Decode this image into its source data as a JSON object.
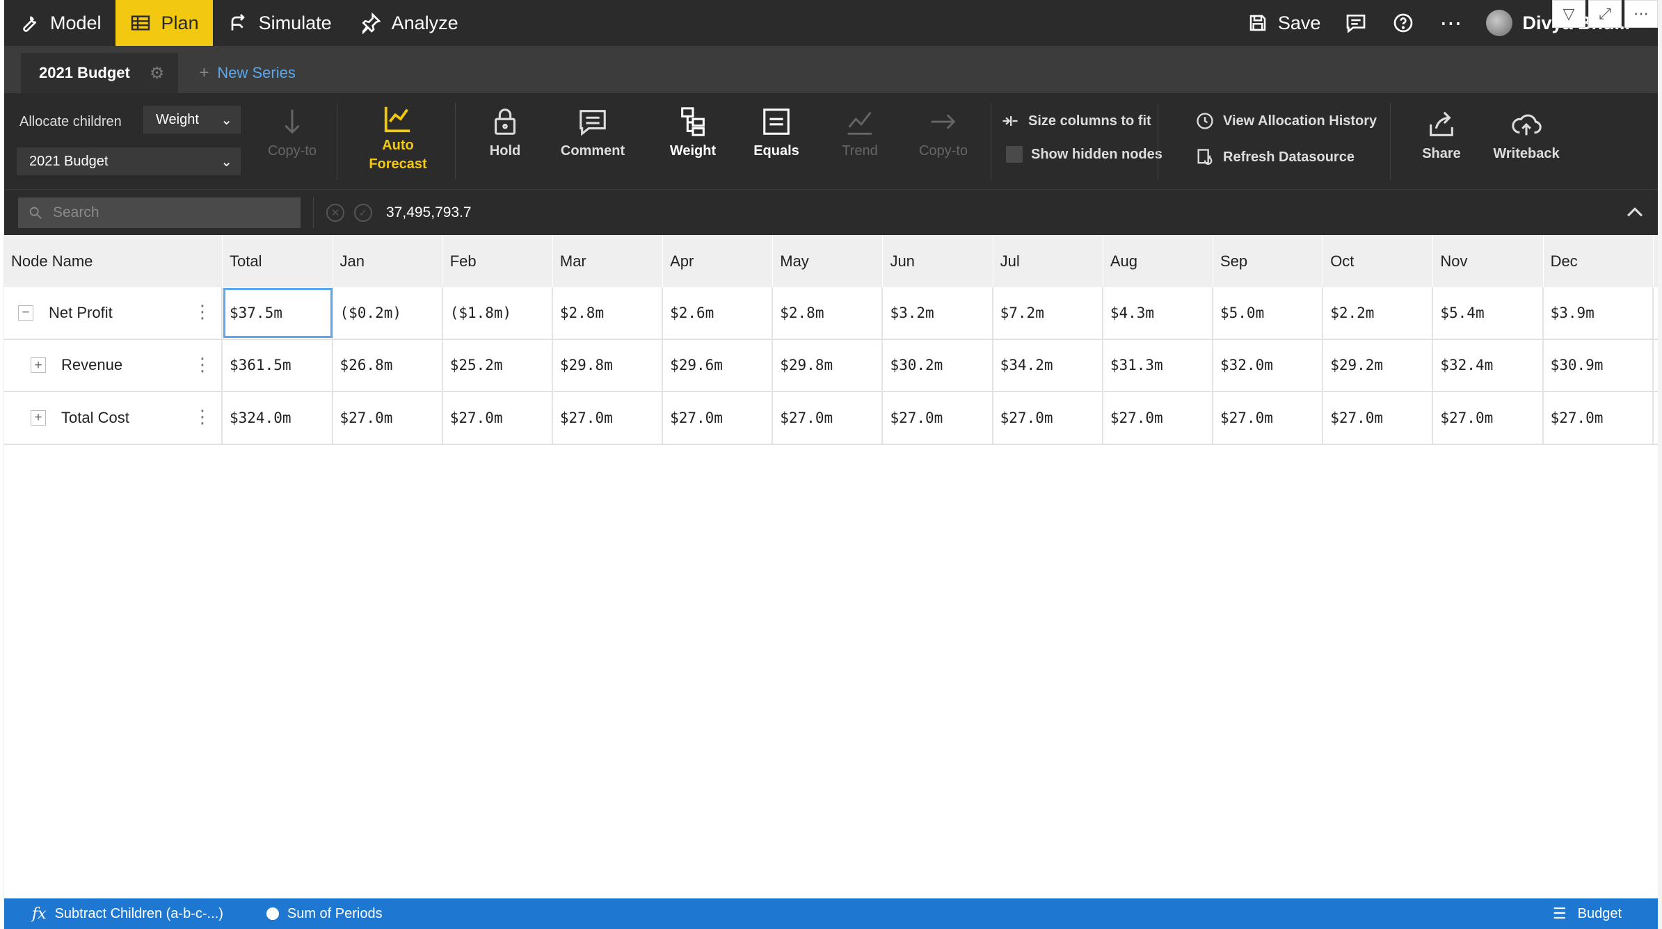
{
  "nav": {
    "items": [
      {
        "label": "Model",
        "icon": "wrench-icon"
      },
      {
        "label": "Plan",
        "icon": "table-icon",
        "active": true
      },
      {
        "label": "Simulate",
        "icon": "branch-icon"
      },
      {
        "label": "Analyze",
        "icon": "pin-icon"
      }
    ],
    "save_label": "Save",
    "user_name": "Divya Bhu..."
  },
  "series": {
    "active_tab": "2021 Budget",
    "new_series_label": "New Series"
  },
  "ribbon": {
    "allocate_label": "Allocate children",
    "allocate_value": "Weight",
    "series_select_value": "2021 Budget",
    "copy_to_1": "Copy-to",
    "auto_forecast_line1": "Auto",
    "auto_forecast_line2": "Forecast",
    "hold": "Hold",
    "comment": "Comment",
    "weight": "Weight",
    "equals": "Equals",
    "trend": "Trend",
    "copy_to_2": "Copy-to",
    "size_columns": "Size columns to fit",
    "show_hidden": "Show hidden nodes",
    "view_history": "View Allocation History",
    "refresh": "Refresh Datasource",
    "share": "Share",
    "writeback": "Writeback"
  },
  "formula": {
    "search_placeholder": "Search",
    "value": "37,495,793.7"
  },
  "grid": {
    "headers": [
      "Node Name",
      "Total",
      "Jan",
      "Feb",
      "Mar",
      "Apr",
      "May",
      "Jun",
      "Jul",
      "Aug",
      "Sep",
      "Oct",
      "Nov",
      "Dec"
    ],
    "rows": [
      {
        "name": "Net Profit",
        "expander": "−",
        "values": [
          "$37.5m",
          "($0.2m)",
          "($1.8m)",
          "$2.8m",
          "$2.6m",
          "$2.8m",
          "$3.2m",
          "$7.2m",
          "$4.3m",
          "$5.0m",
          "$2.2m",
          "$5.4m",
          "$3.9m"
        ]
      },
      {
        "name": "Revenue",
        "expander": "+",
        "values": [
          "$361.5m",
          "$26.8m",
          "$25.2m",
          "$29.8m",
          "$29.6m",
          "$29.8m",
          "$30.2m",
          "$34.2m",
          "$31.3m",
          "$32.0m",
          "$29.2m",
          "$32.4m",
          "$30.9m"
        ]
      },
      {
        "name": "Total Cost",
        "expander": "+",
        "values": [
          "$324.0m",
          "$27.0m",
          "$27.0m",
          "$27.0m",
          "$27.0m",
          "$27.0m",
          "$27.0m",
          "$27.0m",
          "$27.0m",
          "$27.0m",
          "$27.0m",
          "$27.0m",
          "$27.0m"
        ]
      }
    ]
  },
  "status": {
    "formula_label": "Subtract Children (a-b-c-...)",
    "aggregation_label": "Sum of Periods",
    "measure_label": "Budget"
  },
  "colors": {
    "accent_yellow": "#f2c811",
    "status_blue": "#1e78d2",
    "selection_blue": "#5aa8f0"
  }
}
